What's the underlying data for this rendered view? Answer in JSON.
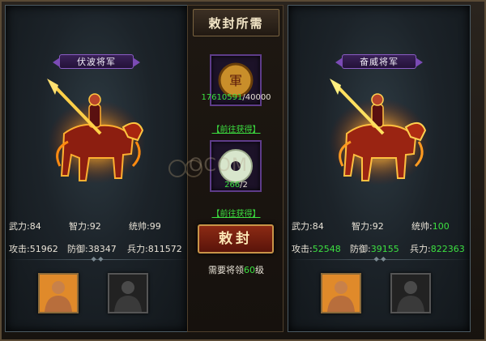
{
  "center": {
    "title": "敕封所需",
    "item1": {
      "icon": "military-seal-icon",
      "have": "17610591",
      "sep": "/",
      "need": "40000",
      "link": "【前往获得】"
    },
    "item2": {
      "icon": "jade-disc-icon",
      "have": "266",
      "sep": "/",
      "need": "2",
      "link": "【前往获得】"
    },
    "button_label": "敕封",
    "requirement_prefix": "需要将领",
    "requirement_level": "60",
    "requirement_suffix": "级"
  },
  "left": {
    "title": "伏波将军",
    "stats": {
      "wuli_label": "武力:",
      "wuli": "84",
      "zhili_label": "智力:",
      "zhili": "92",
      "tongshuai_label": "统帅:",
      "tongshuai": "99",
      "gongji_label": "攻击:",
      "gongji": "51962",
      "fangyu_label": "防御:",
      "fangyu": "38347",
      "bingli_label": "兵力:",
      "bingli": "811572"
    }
  },
  "right": {
    "title": "奋威将军",
    "stats": {
      "wuli_label": "武力:",
      "wuli": "84",
      "zhili_label": "智力:",
      "zhili": "92",
      "tongshuai_label": "统帅:",
      "tongshuai": "100",
      "gongji_label": "攻击:",
      "gongji": "52548",
      "fangyu_label": "防御:",
      "fangyu": "39155",
      "bingli_label": "兵力:",
      "bingli": "822363"
    }
  },
  "watermark": {
    "text": "OCOM",
    "sub": "玩游戏 EXY"
  },
  "colors": {
    "green": "#3ce040",
    "panel_border": "#4b5a63",
    "title_purple": "#8a5cc4",
    "button_red": "#8c2a14",
    "gold": "#c89448"
  }
}
